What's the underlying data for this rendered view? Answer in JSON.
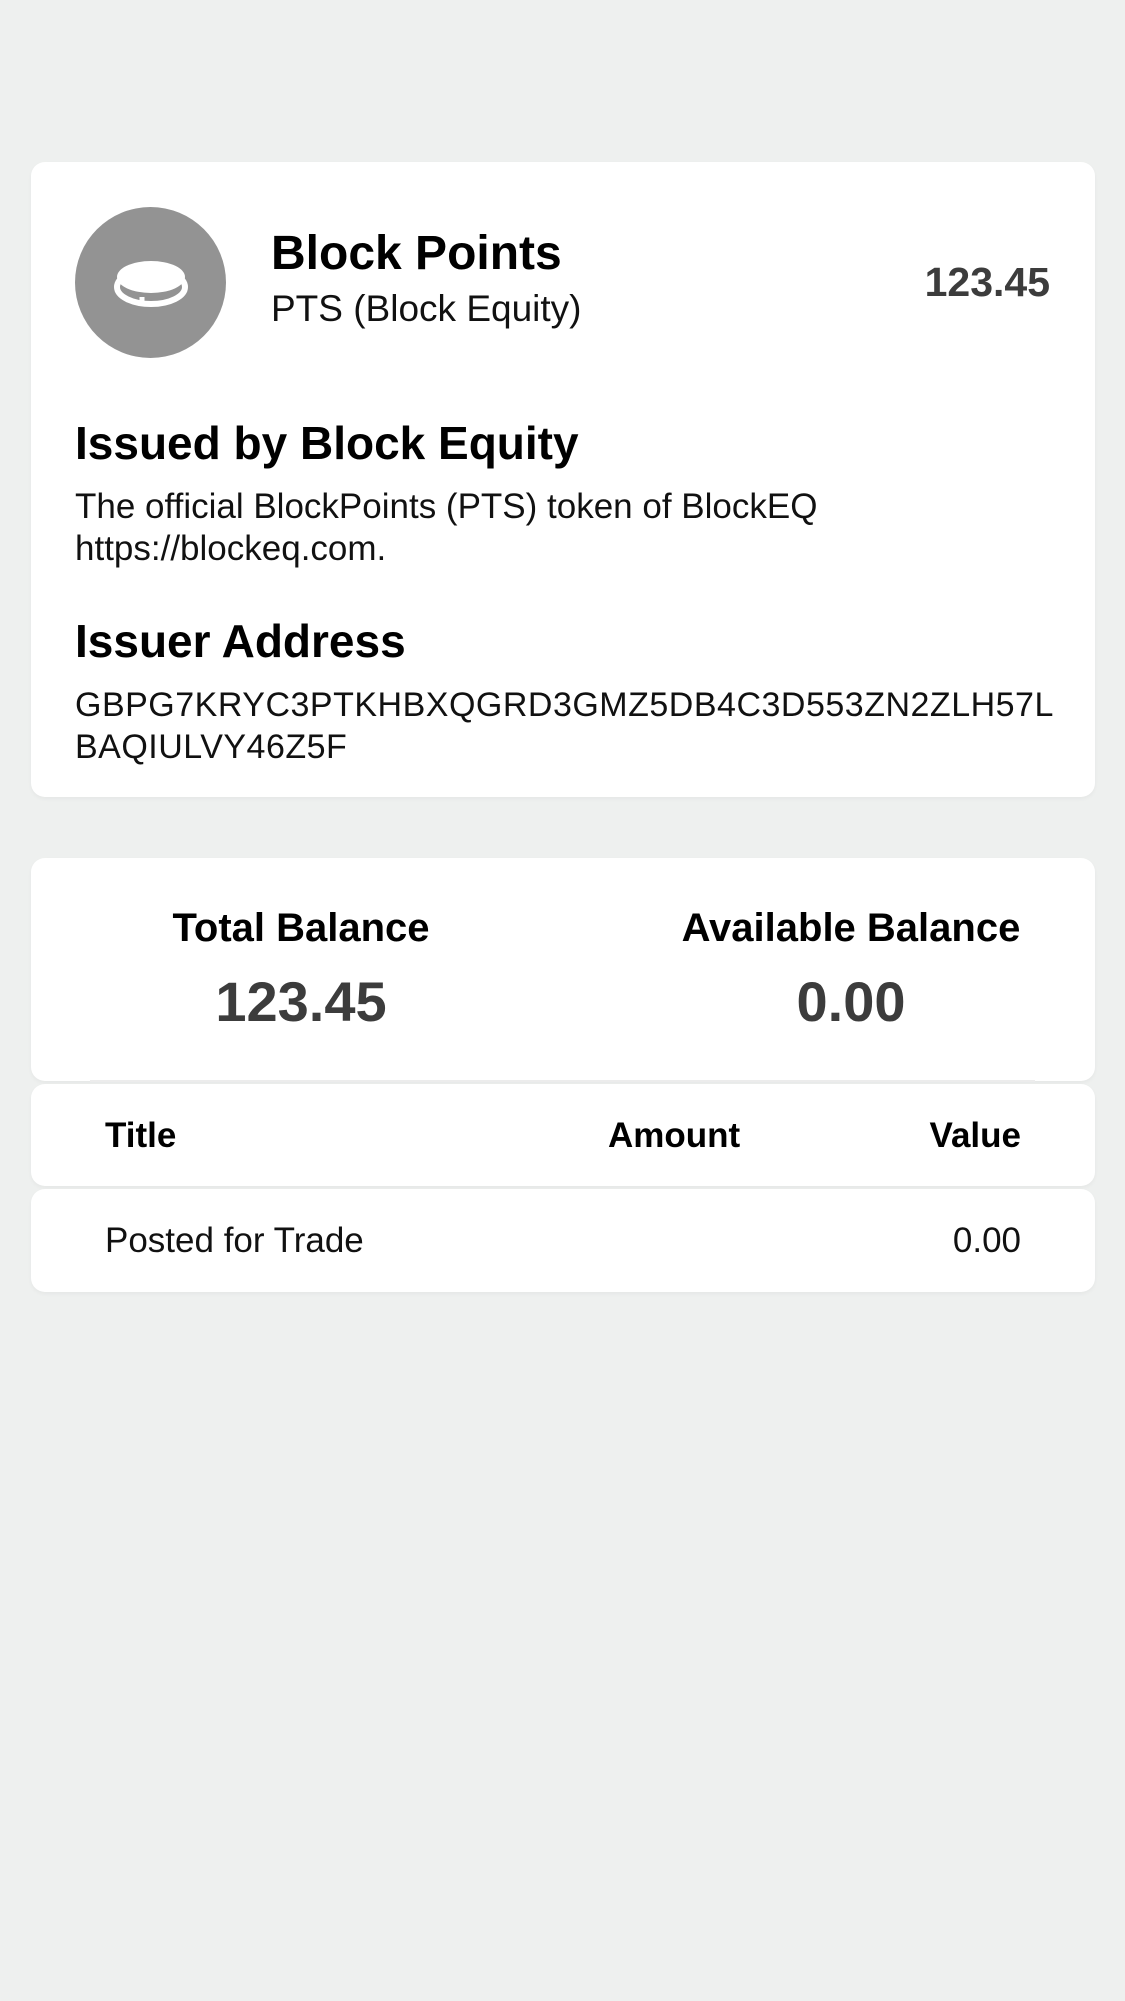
{
  "asset": {
    "icon": "coin-icon",
    "name": "Block Points",
    "code": "PTS (Block Equity)",
    "balance": "123.45",
    "issued_by": "Issued by Block Equity",
    "description": "The official BlockPoints (PTS) token of BlockEQ https://blockeq.com.",
    "issuer_address_label": "Issuer Address",
    "issuer_address": "GBPG7KRYC3PTKHBXQGRD3GMZ5DB4C3D553ZN2ZLH57LBAQIULVY46Z5F"
  },
  "balances": {
    "total_label": "Total Balance",
    "total_value": "123.45",
    "available_label": "Available Balance",
    "available_value": "0.00"
  },
  "table": {
    "headers": {
      "title": "Title",
      "amount": "Amount",
      "value": "Value"
    },
    "rows": [
      {
        "title": "Posted for Trade",
        "amount": "",
        "value": "0.00"
      }
    ]
  },
  "colors": {
    "background": "#eef0ef",
    "card": "#ffffff",
    "icon_circle": "#939393"
  }
}
